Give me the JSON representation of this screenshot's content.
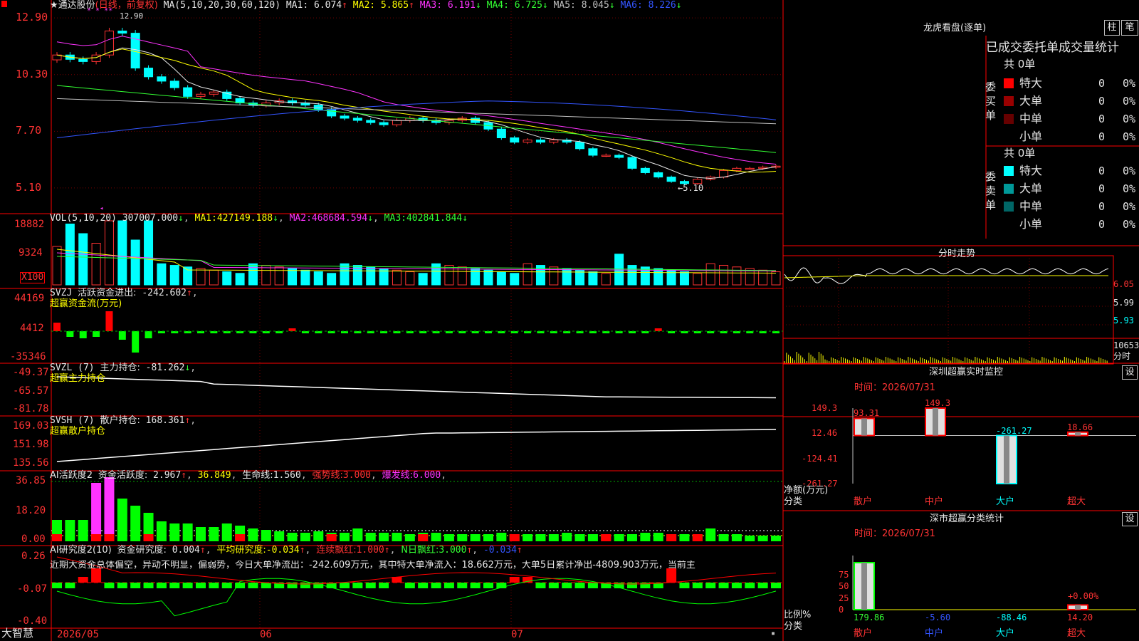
{
  "stock": {
    "name": "通达股份",
    "period": "(日线，前复权)"
  },
  "main": {
    "ma_params": "MA(5,10,20,30,60,120)",
    "legend": [
      {
        "label": "MA1:",
        "value": "6.074",
        "arrow": "↑",
        "color": "#e6e6e6"
      },
      {
        "label": "MA2:",
        "value": "5.865",
        "arrow": "↑",
        "color": "#ffff00"
      },
      {
        "label": "MA3:",
        "value": "6.191",
        "arrow": "↓",
        "color": "#ff33ff"
      },
      {
        "label": "MA4:",
        "value": "6.725",
        "arrow": "↓",
        "color": "#33ff33"
      },
      {
        "label": "MA5:",
        "value": "8.045",
        "arrow": "↓",
        "color": "#c0c0c0"
      },
      {
        "label": "MA6:",
        "value": "8.226",
        "arrow": "↓",
        "color": "#3355ff"
      }
    ],
    "y_ticks": [
      "12.90",
      "10.30",
      "7.70",
      "5.10"
    ],
    "high_label": "12.90",
    "low_label": "←5.10",
    "low_marker": "◂"
  },
  "vol": {
    "title": "VOL(5,10,20)",
    "value": "307007.000",
    "arrow": "↓",
    "ma1": "427149.188",
    "ma1_arrow": "↓",
    "ma2": "468684.594",
    "ma2_arrow": "↓",
    "ma3": "402841.844",
    "ma3_arrow": "↓",
    "ma1_label": "MA1:",
    "ma2_label": "MA2:",
    "ma3_label": "MA3:",
    "y_ticks": [
      "18882",
      "9324"
    ],
    "unit": "X100"
  },
  "svzj": {
    "title": "SVZJ",
    "label": "活跃资金进出:",
    "value": "-242.602",
    "arrow": "↑",
    "subtitle": "超赢资金流(万元)",
    "y_ticks": [
      "44169",
      "4412",
      "-35346"
    ]
  },
  "svzl": {
    "title": "SVZL (7)",
    "label": "主力持仓:",
    "value": "-81.262",
    "arrow": "↓",
    "subtitle": "超赢主力持仓",
    "y_ticks": [
      "-49.37",
      "-65.57",
      "-81.78"
    ]
  },
  "svsh": {
    "title": "SVSH (7)",
    "label": "散户持仓:",
    "value": "168.361",
    "arrow": "↑",
    "subtitle": "超赢散户持仓",
    "y_ticks": [
      "169.03",
      "151.98",
      "135.56"
    ]
  },
  "ai_act": {
    "title": "AI活跃度2",
    "label": "资金活跃度:",
    "value": "2.967",
    "arrow": "↑",
    "v2": "36.849",
    "life_label": "生命线:",
    "life": "1.560",
    "strong_label": "强势线:",
    "strong": "3.000",
    "burst_label": "爆发线:",
    "burst": "6.000",
    "y_ticks": [
      "36.85",
      "18.20",
      "0.00"
    ]
  },
  "ai_res": {
    "title": "AI研究度2(10)",
    "label": "资金研究度:",
    "value": "0.004",
    "arrow": "↑",
    "avg_label": "平均研究度:",
    "avg": "-0.034",
    "avg_arrow": "↑",
    "cont_label": "连续飘红:",
    "cont": "1.000",
    "cont_arrow": "↑",
    "n_label": "N日飘红:",
    "n": "3.000",
    "n_arrow": "↑",
    "last": "-0.034",
    "last_arrow": "↑",
    "y_ticks": [
      "0.26",
      "-0.07",
      "-0.40"
    ],
    "comment": "近期大资金总体偏空，异动不明显，偏弱势，今日大单净流出：-242.609万元，其中特大单净流入：18.662万元，大单5日累计净出-4809.903万元，当前主"
  },
  "x_axis": [
    "2026/05",
    "06",
    "07"
  ],
  "brand": "大智慧",
  "right": {
    "lhb_title": "龙虎看盘(逐单)",
    "tab_zhu": "柱",
    "tab_bi": "笔",
    "stats_title": "已成交委托单成交量统计",
    "buy_side": "委买单",
    "sell_side": "委卖单",
    "buy_total": "共 0单",
    "sell_total": "共 0单",
    "buy_rows": [
      {
        "name": "特大",
        "n": "0",
        "p": "0%",
        "color": "#ff0000"
      },
      {
        "name": "大单",
        "n": "0",
        "p": "0%",
        "color": "#990000"
      },
      {
        "name": "中单",
        "n": "0",
        "p": "0%",
        "color": "#660000"
      },
      {
        "name": "小单",
        "n": "0",
        "p": "0%",
        "color": ""
      }
    ],
    "sell_rows": [
      {
        "name": "特大",
        "n": "0",
        "p": "0%",
        "color": "#00ffff"
      },
      {
        "name": "大单",
        "n": "0",
        "p": "0%",
        "color": "#009999"
      },
      {
        "name": "中单",
        "n": "0",
        "p": "0%",
        "color": "#006666"
      },
      {
        "name": "小单",
        "n": "0",
        "p": "0%",
        "color": ""
      }
    ],
    "fs_title": "分时走势",
    "fs_ticks": [
      "6.05",
      "5.99",
      "5.93"
    ],
    "fs_vol_tick": "10653",
    "fs_vol_label": "分时",
    "monitor_title": "深圳超赢实时监控",
    "set_label": "设",
    "time_label": "时间：2026/07/31",
    "mon_ticks": [
      "149.3",
      "12.46",
      "-124.41",
      "-261.27"
    ],
    "mon_vals": [
      "93.31",
      "149.3",
      "-261.27",
      "18.66"
    ],
    "mon_y_unit": "净额(万元)",
    "mon_x_unit": "分类",
    "categories": [
      "散户",
      "中户",
      "大户",
      "超大"
    ],
    "cls_title": "深市超赢分类统计",
    "cls_time": "时间：2026/07/31",
    "cls_ticks": [
      "75",
      "50",
      "25",
      "0"
    ],
    "cls_vals": [
      "179.86",
      "-5.60",
      "-88.46",
      "14.20"
    ],
    "cls_pct": "+0.00%",
    "cls_y_unit": "比例%",
    "cls_x_unit": "分类"
  },
  "chart_data": [
    {
      "type": "candlestick",
      "title": "通达股份(日线，前复权)",
      "x_ticks": [
        "2026/05",
        "06",
        "07"
      ],
      "y_ticks": [
        12.9,
        10.3,
        7.7,
        5.1
      ],
      "high": 12.9,
      "low": 5.1,
      "ma_last": {
        "MA1": 6.074,
        "MA2": 5.865,
        "MA3": 6.191,
        "MA4": 6.725,
        "MA5": 8.045,
        "MA6": 8.226
      },
      "close": [
        11.2,
        11.0,
        10.9,
        11.2,
        12.3,
        12.2,
        10.6,
        10.2,
        10.0,
        9.7,
        9.3,
        9.4,
        9.5,
        9.2,
        9.0,
        8.9,
        9.0,
        9.1,
        9.0,
        8.9,
        8.7,
        8.4,
        8.3,
        8.2,
        8.1,
        8.0,
        8.2,
        8.3,
        8.2,
        8.1,
        8.2,
        8.3,
        8.1,
        7.8,
        7.4,
        7.2,
        7.3,
        7.2,
        7.3,
        7.2,
        6.9,
        6.6,
        6.6,
        6.5,
        6.0,
        5.8,
        5.6,
        5.4,
        5.3,
        5.5,
        5.6,
        5.9,
        6.0,
        6.0,
        6.05,
        6.1
      ]
    },
    {
      "type": "bar",
      "title": "VOL(5,10,20)",
      "y_ticks": [
        18882,
        9324
      ],
      "last": 307007.0,
      "ma": {
        "MA1": 427149.188,
        "MA2": 468684.594,
        "MA3": 402841.844
      }
    },
    {
      "type": "bar",
      "title": "SVZJ 活跃资金进出",
      "y_ticks": [
        44169,
        4412,
        -35346
      ],
      "last": -242.602
    },
    {
      "type": "line",
      "title": "SVZL (7) 主力持仓",
      "y_ticks": [
        -49.37,
        -65.57,
        -81.78
      ],
      "last": -81.262
    },
    {
      "type": "line",
      "title": "SVSH (7) 散户持仓",
      "y_ticks": [
        169.03,
        151.98,
        135.56
      ],
      "last": 168.361
    },
    {
      "type": "bar",
      "title": "AI活跃度2",
      "y_ticks": [
        36.85,
        18.2,
        0.0
      ],
      "last": 2.967,
      "lines": {
        "生命线": 1.56,
        "强势线": 3.0,
        "爆发线": 6.0
      }
    },
    {
      "type": "bar",
      "title": "AI研究度2(10)",
      "y_ticks": [
        0.26,
        -0.07,
        -0.4
      ],
      "last": 0.004,
      "avg": -0.034
    },
    {
      "type": "bar",
      "title": "深圳超赢实时监控",
      "categories": [
        "散户",
        "中户",
        "大户",
        "超大"
      ],
      "values": [
        93.31,
        149.3,
        -261.27,
        18.66
      ],
      "ylabel": "净额(万元)",
      "xlabel": "分类",
      "y_ticks": [
        149.3,
        12.46,
        -124.41,
        -261.27
      ]
    },
    {
      "type": "bar",
      "title": "深市超赢分类统计",
      "categories": [
        "散户",
        "中户",
        "大户",
        "超大"
      ],
      "values": [
        179.86,
        -5.6,
        -88.46,
        14.2
      ],
      "ylabel": "比例%",
      "xlabel": "分类",
      "y_ticks": [
        75,
        50,
        25,
        0
      ]
    }
  ]
}
